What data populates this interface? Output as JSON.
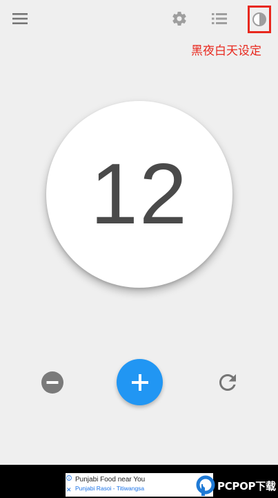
{
  "toolbar": {
    "menu_icon": "hamburger-menu-icon",
    "settings_icon": "gear-icon",
    "list_icon": "list-icon",
    "theme_icon": "half-circle-contrast-icon"
  },
  "annotation": {
    "text": "黑夜白天设定",
    "color": "#e8281e"
  },
  "counter": {
    "value": "12"
  },
  "controls": {
    "minus_icon": "minus-circle-icon",
    "plus_icon": "plus-icon",
    "reset_icon": "refresh-icon",
    "accent_color": "#2196f3"
  },
  "ad": {
    "title": "Punjabi Food near You",
    "subtitle": "Punjabi Rasoi - Titiwangsa",
    "close_label": "✕"
  },
  "watermark": {
    "text": "PCPOP下载"
  }
}
